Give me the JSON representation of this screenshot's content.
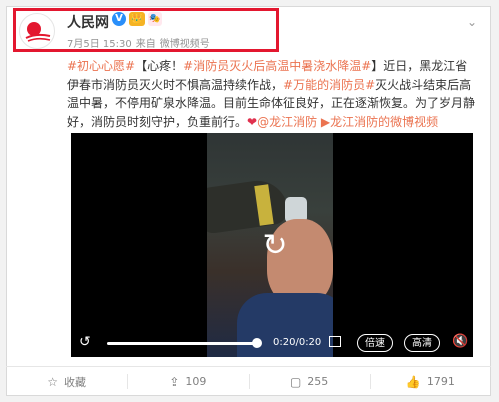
{
  "post": {
    "account_name": "人民网",
    "badges": {
      "verified": "V",
      "crown": "👑",
      "mask": "🎭"
    },
    "meta": {
      "date": "7月5日 15:30",
      "sep": "来自",
      "source": "微博视频号"
    },
    "text": {
      "tag1": "#初心心愿#",
      "t1": "【心疼！",
      "tag2": "#消防员灭火后高温中暑浇水降温#",
      "t2": "】近日，黑龙江省伊春市消防员灭火时不惧高温持续作战，",
      "tag3": "#万能的消防员#",
      "t3": "灭火战斗结束后高温中暑，不停用矿泉水降温。目前生命体征良好，正在逐渐恢复。为了岁月静好，消防员时刻守护，负重前行。",
      "heart": "❤",
      "mention": "@龙江消防",
      "video_link": "龙江消防的微博视频"
    }
  },
  "video": {
    "time": "0:20/0:20",
    "progress": 1.0,
    "speed_label": "倍速",
    "quality_label": "高清"
  },
  "actions": {
    "favorite": "收藏",
    "repost": "109",
    "comment": "255",
    "like": "1791"
  }
}
